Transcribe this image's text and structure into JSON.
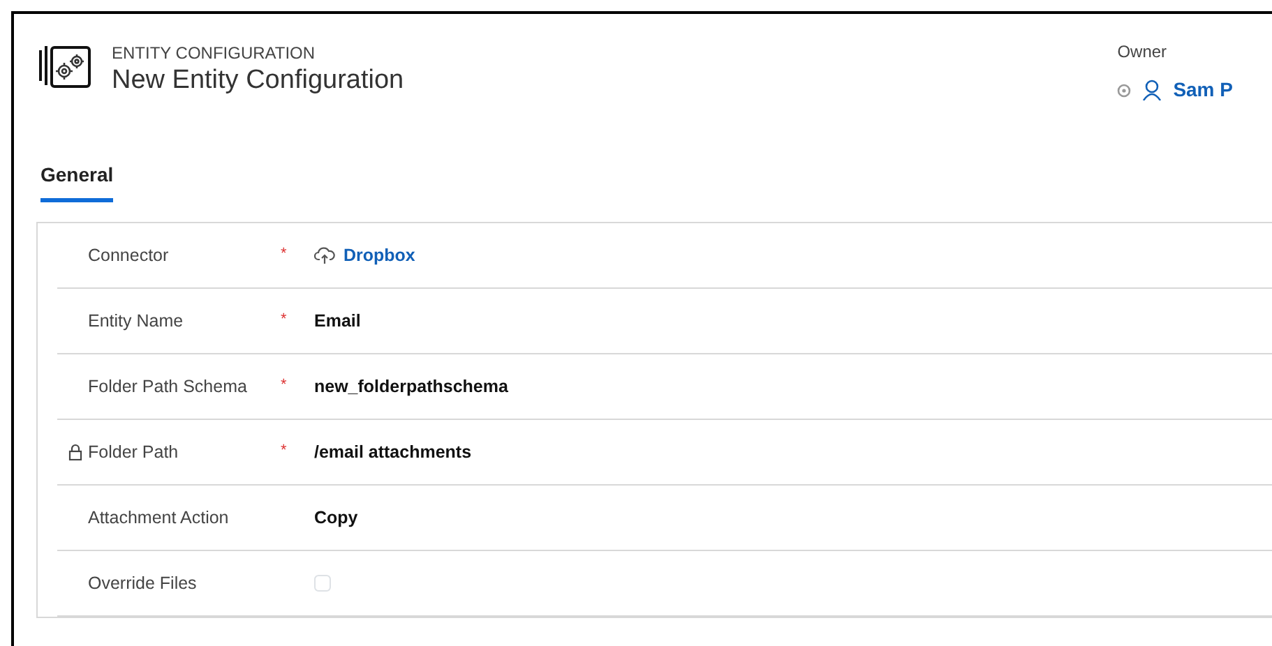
{
  "header": {
    "entity_type": "ENTITY CONFIGURATION",
    "title": "New Entity Configuration",
    "owner_label": "Owner",
    "owner_name": "Sam P"
  },
  "tabs": [
    {
      "label": "General",
      "selected": true
    }
  ],
  "fields": [
    {
      "label": "Connector",
      "required_mark": "*",
      "locked": false,
      "kind": "link",
      "value": "Dropbox"
    },
    {
      "label": "Entity Name",
      "required_mark": "*",
      "locked": false,
      "kind": "text",
      "value": "Email"
    },
    {
      "label": "Folder Path Schema",
      "required_mark": "*",
      "locked": false,
      "kind": "text",
      "value": "new_folderpathschema"
    },
    {
      "label": "Folder Path",
      "required_mark": "*",
      "locked": true,
      "kind": "text",
      "value": "/email attachments"
    },
    {
      "label": "Attachment Action",
      "locked": false,
      "kind": "text",
      "value": "Copy"
    },
    {
      "label": "Override Files",
      "locked": false,
      "kind": "checkbox",
      "checked": false
    }
  ]
}
